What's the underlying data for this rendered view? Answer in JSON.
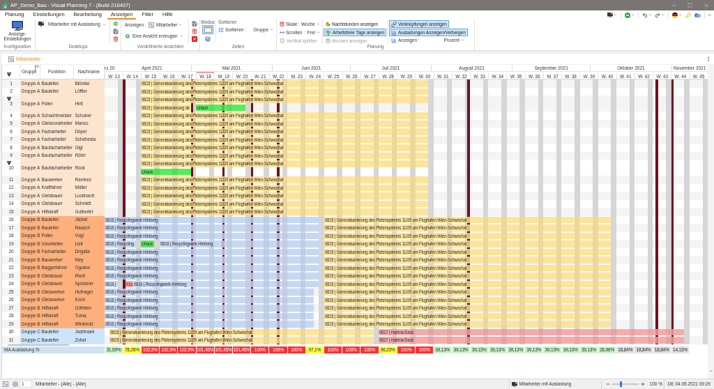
{
  "window": {
    "title": "AP_Demo_Bau - Visual Planning 7 - (Build 210407)"
  },
  "menu_tabs": [
    {
      "label": "Planung",
      "selected": false
    },
    {
      "label": "Einstellungen",
      "selected": false
    },
    {
      "label": "Bearbeitung",
      "selected": false
    },
    {
      "label": "Anzeigen",
      "selected": true
    },
    {
      "label": "Filter",
      "selected": false
    },
    {
      "label": "Hilfe",
      "selected": false
    }
  ],
  "ribbon": {
    "groups": [
      {
        "kind": "konfiguration",
        "label": "Konfiguration",
        "button": "Anzeige-Einstellungen"
      },
      {
        "kind": "desktops",
        "label": "Desktops",
        "dropdown": "Mitarbeiter mit Auslastung"
      },
      {
        "kind": "views",
        "label": "Vordefinierte Ansichten",
        "show_label": "Anzeigen :",
        "show_value": "Mitarbeiter",
        "create": "Eine Ansicht erzeugen"
      },
      {
        "kind": "cells",
        "label": "Zellen",
        "mode_caption": "Modus",
        "mode_buttons": [
          {
            "selected": true
          },
          {
            "selected": false
          }
        ],
        "sort_caption": "Sortieren",
        "sort_label": "Sortieren :",
        "sort_value": "Gruppe"
      },
      {
        "kind": "planning",
        "label": "Planung",
        "scale_label": "Skale :",
        "scale_value": "Woche",
        "scroll_label": "Scrollen :",
        "scroll_value": "Frei",
        "split": {
          "label": "Vertikal splitten",
          "disabled": true
        },
        "toggles": [
          {
            "label": "Nachtstunden anzeigen",
            "selected": false,
            "disabled": false
          },
          {
            "label": "Arbeitsfreie Tage anzeigen",
            "selected": true,
            "disabled": false
          },
          {
            "label": "Wochen anzeigen",
            "selected": false,
            "disabled": true
          }
        ],
        "toggles_2": [
          {
            "label": "Verknüpfungen anzeigen",
            "selected": true
          },
          {
            "label": "Auslastungen Anzeigen/Verbergen",
            "selected": true
          }
        ],
        "display_label": "Anzeigen :",
        "display_value": "Prozent"
      }
    ]
  },
  "panel": {
    "title": "Mitarbeiter"
  },
  "table": {
    "expanded": true,
    "columns": [
      "Gruppe",
      "Funktion",
      "Nachname"
    ]
  },
  "timeline": {
    "months": [
      "rz 20",
      "April 2021",
      "Mai 2021",
      "Juni 2021",
      "Juli 2021",
      "August 2021",
      "September 2021",
      "Oktober 2021",
      "November 2021"
    ],
    "weeks": [
      {
        "label": "W. 13",
        "current": false
      },
      {
        "label": "W. 14",
        "current": false
      },
      {
        "label": "W. 15",
        "current": false
      },
      {
        "label": "W. 16",
        "current": false
      },
      {
        "label": "W. 17",
        "current": false
      },
      {
        "label": "W. 18",
        "current": true
      },
      {
        "label": "W. 19",
        "current": false
      },
      {
        "label": "W. 20",
        "current": false
      },
      {
        "label": "W. 21",
        "current": false
      },
      {
        "label": "W. 22",
        "current": false
      },
      {
        "label": "W. 23",
        "current": false
      },
      {
        "label": "W. 24",
        "current": false
      },
      {
        "label": "W. 25",
        "current": false
      },
      {
        "label": "W. 26",
        "current": false
      },
      {
        "label": "W. 27",
        "current": false
      },
      {
        "label": "W. 28",
        "current": false
      },
      {
        "label": "W. 29",
        "current": false
      },
      {
        "label": "W. 30",
        "current": false
      },
      {
        "label": "W. 31",
        "current": false
      },
      {
        "label": "W. 32",
        "current": false
      },
      {
        "label": "W. 33",
        "current": false
      },
      {
        "label": "W. 34",
        "current": false
      },
      {
        "label": "W. 35",
        "current": false
      },
      {
        "label": "W. 36",
        "current": false
      },
      {
        "label": "W. 37",
        "current": false
      },
      {
        "label": "W. 38",
        "current": false
      },
      {
        "label": "W. 39",
        "current": false
      },
      {
        "label": "W. 40",
        "current": false
      },
      {
        "label": "W. 41",
        "current": false
      },
      {
        "label": "W. 42",
        "current": false
      },
      {
        "label": "W. 43",
        "current": false
      },
      {
        "label": "W. 44",
        "current": false
      },
      {
        "label": "W. 45",
        "current": false
      }
    ]
  },
  "rows": [
    {
      "number": "1",
      "gruppe": "Gruppe A",
      "funktion": "Bauleiter",
      "nachname": "Blümke",
      "color": "#fde4ce",
      "expanded": false,
      "lanes": [
        [
          {
            "text": "0815 | Generalsanierung des Pistensystems 11/29 am Flughafen Wien-Schwechat",
            "color": "#fde49b"
          }
        ]
      ]
    },
    {
      "number": "2",
      "gruppe": "Gruppe A",
      "funktion": "Bauleiter",
      "nachname": "Löffler",
      "color": "#fde4ce",
      "expanded": false,
      "lanes": [
        [
          {
            "text": "0815 | Generalsanierung des Pistensystems 11/29 am Flughafen Wien-Schwechat",
            "color": "#fde49b"
          }
        ]
      ]
    },
    {
      "number": "3",
      "gruppe": "Gruppe A",
      "funktion": "Polier",
      "nachname": "Hirtl",
      "color": "#fde4ce",
      "expanded": true,
      "lanes": [
        [
          {
            "text": "0815 | Generalsanierung des Pistensystems 11/29 am Flughafen Wien-Schwechat",
            "color": "#fde49b"
          }
        ],
        [
          {
            "text": "0815 | Generalsanierung de",
            "color": "#fde49b"
          },
          {
            "text": "Urlaub",
            "color": "#55ee55"
          }
        ]
      ]
    },
    {
      "number": "4",
      "gruppe": "Gruppe A",
      "funktion": "Schachtmeister",
      "nachname": "Schober",
      "color": "#fde4ce",
      "expanded": false,
      "lanes": [
        [
          {
            "text": "0815 | Generalsanierung des Pistensystems 11/29 am Flughafen Wien-Schwechat",
            "color": "#fde49b"
          }
        ]
      ]
    },
    {
      "number": "5",
      "gruppe": "Gruppe A",
      "funktion": "Gleisvorarbeiter",
      "nachname": "Manco",
      "color": "#fde4ce",
      "expanded": false,
      "lanes": [
        [
          {
            "text": "0815 | Generalsanierung des Pistensystems 11/29 am Flughafen Wien-Schwechat",
            "color": "#fde49b"
          }
        ]
      ]
    },
    {
      "number": "6",
      "gruppe": "Gruppe A",
      "funktion": "Facharbeiter",
      "nachname": "Döpel",
      "color": "#fde4ce",
      "expanded": false,
      "lanes": [
        [
          {
            "text": "0815 | Generalsanierung des Pistensystems 11/29 am Flughafen Wien-Schwechat",
            "color": "#fde49b"
          }
        ]
      ]
    },
    {
      "number": "7",
      "gruppe": "Gruppe A",
      "funktion": "Facharbeiter",
      "nachname": "Schebesta",
      "color": "#fde4ce",
      "expanded": false,
      "lanes": [
        [
          {
            "text": "0815 | Generalsanierung des Pistensystems 11/29 am Flughafen Wien-Schwechat",
            "color": "#fde49b"
          }
        ]
      ]
    },
    {
      "number": "8",
      "gruppe": "Gruppe A",
      "funktion": "Baufacharbeiter",
      "nachname": "Gigl",
      "color": "#fde4ce",
      "expanded": false,
      "lanes": [
        [
          {
            "text": "0815 | Generalsanierung des Pistensystems 11/29 am Flughafen Wien-Schwechat",
            "color": "#fde49b"
          }
        ]
      ]
    },
    {
      "number": "9",
      "gruppe": "Gruppe A",
      "funktion": "Baufacharbeiter",
      "nachname": "Röhrl",
      "color": "#fde4ce",
      "expanded": false,
      "lanes": [
        [
          {
            "text": "0815 | Generalsanierung des Pistensystems 11/29 am Flughafen Wien-Schwechat",
            "color": "#fde49b"
          }
        ]
      ]
    },
    {
      "number": "10",
      "gruppe": "Gruppe A",
      "funktion": "Baufacharbeiter",
      "nachname": "Rock",
      "color": "#fde4ce",
      "expanded": true,
      "lanes": [
        [
          {
            "text": "0815 | Generalsanierung des Pistensystems 11/29 am Flughafen Wien-Schwechat",
            "color": "#fde49b"
          }
        ],
        [
          {
            "text": "Urlaub",
            "color": "#55ee55"
          }
        ]
      ]
    },
    {
      "number": "11",
      "gruppe": "Gruppe A",
      "funktion": "Bauwerker",
      "nachname": "Ramirez",
      "color": "#fde4ce",
      "expanded": false,
      "lanes": [
        [
          {
            "text": "0815 | Generalsanierung des Pistensystems 11/29 am Flughafen Wien-Schwechat",
            "color": "#fde49b"
          }
        ]
      ]
    },
    {
      "number": "12",
      "gruppe": "Gruppe A",
      "funktion": "Kraftfahrer",
      "nachname": "Müller",
      "color": "#fde4ce",
      "expanded": false,
      "lanes": [
        [
          {
            "text": "0815 | Generalsanierung des Pistensystems 11/29 am Flughafen Wien-Schwechat",
            "color": "#fde49b"
          }
        ]
      ]
    },
    {
      "number": "13",
      "gruppe": "Gruppe A",
      "funktion": "Gleisbauer",
      "nachname": "Luckhardt",
      "color": "#fde4ce",
      "expanded": false,
      "lanes": [
        [
          {
            "text": "0815 | Generalsanierung des Pistensystems 11/29 am Flughafen Wien-Schwechat",
            "color": "#fde49b"
          }
        ]
      ]
    },
    {
      "number": "14",
      "gruppe": "Gruppe A",
      "funktion": "Gleisbauer",
      "nachname": "Schmidt",
      "color": "#fde4ce",
      "expanded": false,
      "lanes": [
        [
          {
            "text": "0815 | Generalsanierung des Pistensystems 11/29 am Flughafen Wien-Schwechat",
            "color": "#fde49b"
          }
        ]
      ]
    },
    {
      "number": "15",
      "gruppe": "Gruppe A",
      "funktion": "Hilfskraft",
      "nachname": "Gutberlet",
      "color": "#fde4ce",
      "expanded": false,
      "lanes": [
        [
          {
            "text": "0815 | Generalsanierung des Pistensystems 11/29 am Flughafen Wien-Schwechat",
            "color": "#fde49b"
          }
        ]
      ]
    },
    {
      "number": "16",
      "gruppe": "Gruppe B",
      "funktion": "Bauleiter",
      "nachname": "Jäckel",
      "color": "#fdb07c",
      "expanded": false,
      "lanes": [
        [
          {
            "text": "0816 | Recyclingwerk Himberg",
            "color": "#c7d8f6"
          },
          {
            "text": "0815 | Generalsanierung des Pistensystems 11/29 am Flughafen Wien-Schwechat",
            "color": "#fde49b"
          }
        ]
      ]
    },
    {
      "number": "17",
      "gruppe": "Gruppe B",
      "funktion": "Bauleiter",
      "nachname": "Rausch",
      "color": "#fdb07c",
      "expanded": false,
      "lanes": [
        [
          {
            "text": "0816 | Recyclingwerk Himberg",
            "color": "#c7d8f6"
          },
          {
            "text": "0815 | Generalsanierung des Pistensystems 11/29 am Flughafen Wien-Schwechat",
            "color": "#fde49b"
          }
        ]
      ]
    },
    {
      "number": "18",
      "gruppe": "Gruppe B",
      "funktion": "Polier",
      "nachname": "Vogl",
      "color": "#fdb07c",
      "expanded": false,
      "lanes": [
        [
          {
            "text": "0816 | Recyclingwerk Himberg",
            "color": "#c7d8f6"
          },
          {
            "text": "0815 | Generalsanierung des Pistensystems 11/29 am Flughafen Wien-Schwechat",
            "color": "#fde49b"
          }
        ]
      ]
    },
    {
      "number": "19",
      "gruppe": "Gruppe B",
      "funktion": "Vorarbeiter",
      "nachname": "Listl",
      "color": "#fdb07c",
      "expanded": false,
      "lanes": [
        [
          {
            "text": "0816 | Recycling",
            "color": "#c7d8f6"
          },
          {
            "text": "Urlaub",
            "color": "#55ee55"
          },
          {
            "text": "0816 | Recyclingwerk Himberg",
            "color": "#c7d8f6"
          },
          {
            "text": "0815 | Generalsanierung des Pistensystems 11/29 am Flughafen Wien-Schwechat",
            "color": "#fde49b"
          }
        ]
      ]
    },
    {
      "number": "20",
      "gruppe": "Gruppe B",
      "funktion": "Facharbeiter",
      "nachname": "Drigalla",
      "color": "#fdb07c",
      "expanded": false,
      "lanes": [
        [
          {
            "text": "0816 | Recyclingwerk Himberg",
            "color": "#c7d8f6"
          },
          {
            "text": "0815 | Generalsanierung des Pistensystems 11/29 am Flughafen Wien-Schwechat",
            "color": "#fde49b"
          }
        ]
      ]
    },
    {
      "number": "21",
      "gruppe": "Gruppe B",
      "funktion": "Bauwerker",
      "nachname": "Mey",
      "color": "#fdb07c",
      "expanded": false,
      "lanes": [
        [
          {
            "text": "0816 | Recyclingwerk Himberg",
            "color": "#c7d8f6"
          },
          {
            "text": "0815 | Generalsanierung des Pistensystems 11/29 am Flughafen Wien-Schwechat",
            "color": "#fde49b"
          }
        ]
      ]
    },
    {
      "number": "22",
      "gruppe": "Gruppe B",
      "funktion": "Baggerfahrer",
      "nachname": "Ogulew",
      "color": "#fdb07c",
      "expanded": false,
      "lanes": [
        [
          {
            "text": "0816 | Recyclingwerk Himberg",
            "color": "#c7d8f6"
          },
          {
            "text": "0815 | Generalsanierung des Pistensystems 11/29 am Flughafen Wien-Schwechat",
            "color": "#fde49b"
          }
        ]
      ]
    },
    {
      "number": "23",
      "gruppe": "Gruppe B",
      "funktion": "Gleisbauer",
      "nachname": "Riedl",
      "color": "#fdb07c",
      "expanded": false,
      "lanes": [
        [
          {
            "text": "0816 | Recyclingwerk Himberg",
            "color": "#c7d8f6"
          },
          {
            "text": "0815 | Generalsanierung des Pistensystems 11/29 am Flughafen Wien-Schwechat",
            "color": "#fde49b"
          }
        ]
      ]
    },
    {
      "number": "24",
      "gruppe": "Gruppe B",
      "funktion": "Gleisbauer",
      "nachname": "Spöckner",
      "color": "#fdb07c",
      "expanded": false,
      "lanes": [
        [
          {
            "text": "0816 |",
            "color": "#c7d8f6"
          },
          {
            "text": "Kra",
            "color": "#f5a3a3"
          },
          {
            "text": "0816 | Recyclingwerk Himberg",
            "color": "#c7d8f6"
          },
          {
            "text": "0815 | Generalsanierung des Pistensystems 11/29 am Flughafen Wien-Schwechat",
            "color": "#fde49b"
          }
        ]
      ]
    },
    {
      "number": "25",
      "gruppe": "Gruppe B",
      "funktion": "Gleiswerker",
      "nachname": "Hufnagel",
      "color": "#fdb07c",
      "expanded": false,
      "lanes": [
        [
          {
            "text": "0816 | Recyclingwerk Himberg",
            "color": "#c7d8f6"
          },
          {
            "text": "0815 | Generalsanierung des Pistensystems 11/29 am Flughafen Wien-Schwechat",
            "color": "#fde49b"
          }
        ]
      ]
    },
    {
      "number": "26",
      "gruppe": "Gruppe B",
      "funktion": "Gleiswerker",
      "nachname": "Koch",
      "color": "#fdb07c",
      "expanded": false,
      "lanes": [
        [
          {
            "text": "0816 | Recyclingwerk Himberg",
            "color": "#c7d8f6"
          },
          {
            "text": "0815 | Generalsanierung des Pistensystems 11/29 am Flughafen Wien-Schwechat",
            "color": "#fde49b"
          }
        ]
      ]
    },
    {
      "number": "27",
      "gruppe": "Gruppe B",
      "funktion": "Hilfskraft",
      "nachname": "Güthlein",
      "color": "#fdb07c",
      "expanded": false,
      "lanes": [
        [
          {
            "text": "0816 | Recyclingwerk Himberg",
            "color": "#c7d8f6"
          },
          {
            "text": "0815 | Generalsanierung des Pistensystems 11/29 am Flughafen Wien-Schwechat",
            "color": "#fde49b"
          }
        ]
      ]
    },
    {
      "number": "28",
      "gruppe": "Gruppe B",
      "funktion": "Hilfskraft",
      "nachname": "Tuma",
      "color": "#fdb07c",
      "expanded": false,
      "lanes": [
        [
          {
            "text": "0816 | Recyclingwerk Himberg",
            "color": "#c7d8f6"
          },
          {
            "text": "0815 | Generalsanierung des Pistensystems 11/29 am Flughafen Wien-Schwechat",
            "color": "#fde49b"
          }
        ]
      ]
    },
    {
      "number": "29",
      "gruppe": "Gruppe B",
      "funktion": "Hilfskraft",
      "nachname": "Winkhold",
      "color": "#fdb07c",
      "expanded": false,
      "lanes": [
        [
          {
            "text": "0816 | Recyclingwerk Himberg",
            "color": "#c7d8f6"
          },
          {
            "text": "0815 | Generalsanierung des Pistensystems 11/29 am Flughafen Wien-Schwechat",
            "color": "#fde49b"
          }
        ]
      ]
    },
    {
      "number": "30",
      "gruppe": "Gruppe C",
      "funktion": "Bauleiter",
      "nachname": "Jazbinsek",
      "color": "#cde4fa",
      "expanded": false,
      "lanes": [
        [
          {
            "text": "0815 | Generalsanierung des Pistensystems 11/29 am Flughafen Wien-Schwechat",
            "color": "#fde49b"
          },
          {
            "text": "0817 | Harima Deck",
            "color": "#f6abab"
          }
        ]
      ]
    },
    {
      "number": "31",
      "gruppe": "Gruppe C",
      "funktion": "Bauleiter",
      "nachname": "Zobel",
      "color": "#cde4fa",
      "expanded": false,
      "lanes": [
        [
          {
            "text": "0815 | Generalsanierung des Pistensystems 11/29 am Flughafen Wien-Schwechat",
            "color": "#fde49b"
          },
          {
            "text": "0817 | Harima Deck",
            "color": "#f6abab"
          }
        ]
      ]
    }
  ],
  "summary": {
    "label": "MA Auslastung %",
    "cells": [
      {
        "text": "31,59%",
        "color": "#c8f5c8"
      },
      {
        "text": "78,26%",
        "color": "#ffff3c"
      },
      {
        "text": "102,9%",
        "color": "#ff3030"
      },
      {
        "text": "102,9%",
        "color": "#ff3030"
      },
      {
        "text": "102,9%",
        "color": "#ff3030"
      },
      {
        "text": "101,45%",
        "color": "#ff3030"
      },
      {
        "text": "101,45%",
        "color": "#ff3030"
      },
      {
        "text": "101,45%",
        "color": "#ff3030"
      },
      {
        "text": "100%",
        "color": "#ff3030"
      },
      {
        "text": "100%",
        "color": "#ff3030"
      },
      {
        "text": "100%",
        "color": "#ff3030"
      },
      {
        "text": "97,1%",
        "color": "#ffff3c"
      },
      {
        "text": "100%",
        "color": "#ff3030"
      },
      {
        "text": "100%",
        "color": "#ff3030"
      },
      {
        "text": "100%",
        "color": "#ff3030"
      },
      {
        "text": "96,23%",
        "color": "#ffff3c"
      },
      {
        "text": "100%",
        "color": "#ff3030"
      },
      {
        "text": "100%",
        "color": "#ff3030"
      },
      {
        "text": "39,13%",
        "color": "#c8f5c8"
      },
      {
        "text": "39,13%",
        "color": "#c8f5c8"
      },
      {
        "text": "39,13%",
        "color": "#c8f5c8"
      },
      {
        "text": "39,13%",
        "color": "#c8f5c8"
      },
      {
        "text": "39,13%",
        "color": "#c8f5c8"
      },
      {
        "text": "39,13%",
        "color": "#c8f5c8"
      },
      {
        "text": "39,13%",
        "color": "#c8f5c8"
      },
      {
        "text": "39,13%",
        "color": "#c8f5c8"
      },
      {
        "text": "39,13%",
        "color": "#c8f5c8"
      },
      {
        "text": "26,96%",
        "color": "#c8f5c8"
      },
      {
        "text": "18,84%",
        "color": "#e0e0e0"
      },
      {
        "text": "18,84%",
        "color": "#e0e0e0"
      },
      {
        "text": "18,84%",
        "color": "#e0e0e0"
      },
      {
        "text": "14,13%",
        "color": "#e0e0e0"
      }
    ]
  },
  "status_bar": {
    "records": "1",
    "filter": "Mitarbeiter - (Alle) - (Alle)",
    "desktop": "Mitarbeiter mit Auslastung",
    "zoom": {
      "level": 0.33,
      "reading": "100 %"
    },
    "clock": "DE 04.05.2021 09:29"
  }
}
